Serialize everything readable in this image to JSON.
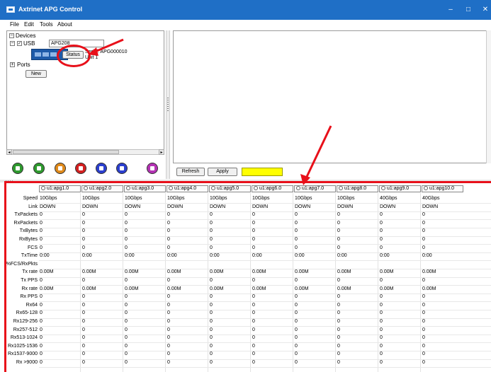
{
  "window": {
    "title": "Axtrinet APG Control",
    "minimize": "–",
    "maximize": "□",
    "close": "✕"
  },
  "menu": [
    "File",
    "Edit",
    "Tools",
    "About"
  ],
  "tree": {
    "devices_label": "Devices",
    "usb_label": "USB",
    "usb_name": "APG208",
    "status_button": "Status",
    "serial_text": "Serial: APG000010",
    "unit_text": "Unit 1",
    "ports_label": "Ports",
    "new_button": "New"
  },
  "controls": [
    {
      "name": "play-icon",
      "color": "#2e9a2e"
    },
    {
      "name": "step-icon",
      "color": "#2e9a2e"
    },
    {
      "name": "pause-icon",
      "color": "#e08a1a"
    },
    {
      "name": "stop-icon",
      "color": "#d42020"
    },
    {
      "name": "zero-icon",
      "color": "#2b3fcf"
    },
    {
      "name": "double-zero-icon",
      "color": "#2b3fcf"
    },
    {
      "name": "cycle-icon",
      "color": "#b432b4"
    }
  ],
  "right_panel": {
    "refresh_button": "Refresh",
    "apply_button": "Apply",
    "indicator_color": "#ffff00"
  },
  "stats": {
    "ports": [
      "u1:apg1.0",
      "u1:apg2.0",
      "u1:apg3.0",
      "u1:apg4.0",
      "u1:apg5.0",
      "u1:apg6.0",
      "u1:apg7.0",
      "u1:apg8.0",
      "u1:apg9.0",
      "u1:apg10.0"
    ],
    "rows": [
      {
        "label": "Speed",
        "values": [
          "10Gbps",
          "10Gbps",
          "10Gbps",
          "10Gbps",
          "10Gbps",
          "10Gbps",
          "10Gbps",
          "10Gbps",
          "40Gbps",
          "40Gbps"
        ]
      },
      {
        "label": "Link",
        "values": [
          "DOWN",
          "DOWN",
          "DOWN",
          "DOWN",
          "DOWN",
          "DOWN",
          "DOWN",
          "DOWN",
          "DOWN",
          "DOWN"
        ]
      },
      {
        "label": "TxPackets",
        "values": [
          "0",
          "0",
          "0",
          "0",
          "0",
          "0",
          "0",
          "0",
          "0",
          "0"
        ]
      },
      {
        "label": "RxPackets",
        "values": [
          "0",
          "0",
          "0",
          "0",
          "0",
          "0",
          "0",
          "0",
          "0",
          "0"
        ]
      },
      {
        "label": "TxBytes",
        "values": [
          "0",
          "0",
          "0",
          "0",
          "0",
          "0",
          "0",
          "0",
          "0",
          "0"
        ]
      },
      {
        "label": "RxBytes",
        "values": [
          "0",
          "0",
          "0",
          "0",
          "0",
          "0",
          "0",
          "0",
          "0",
          "0"
        ]
      },
      {
        "label": "FCS",
        "values": [
          "0",
          "0",
          "0",
          "0",
          "0",
          "0",
          "0",
          "0",
          "0",
          "0"
        ]
      },
      {
        "label": "TxTime",
        "values": [
          "0:00",
          "0:00",
          "0:00",
          "0:00",
          "0:00",
          "0:00",
          "0:00",
          "0:00",
          "0:00",
          "0:00"
        ]
      },
      {
        "label": "%FCS/RxPkts",
        "values": [
          "",
          "",
          "",
          "",
          "",
          "",
          "",
          "",
          "",
          ""
        ]
      },
      {
        "label": "Tx rate",
        "values": [
          "0.00M",
          "0.00M",
          "0.00M",
          "0.00M",
          "0.00M",
          "0.00M",
          "0.00M",
          "0.00M",
          "0.00M",
          "0.00M"
        ]
      },
      {
        "label": "Tx PPS",
        "values": [
          "0",
          "0",
          "0",
          "0",
          "0",
          "0",
          "0",
          "0",
          "0",
          "0"
        ]
      },
      {
        "label": "Rx rate",
        "values": [
          "0.00M",
          "0.00M",
          "0.00M",
          "0.00M",
          "0.00M",
          "0.00M",
          "0.00M",
          "0.00M",
          "0.00M",
          "0.00M"
        ]
      },
      {
        "label": "Rx PPS",
        "values": [
          "0",
          "0",
          "0",
          "0",
          "0",
          "0",
          "0",
          "0",
          "0",
          "0"
        ]
      },
      {
        "label": "Rx64",
        "values": [
          "0",
          "0",
          "0",
          "0",
          "0",
          "0",
          "0",
          "0",
          "0",
          "0"
        ]
      },
      {
        "label": "Rx65-128",
        "values": [
          "0",
          "0",
          "0",
          "0",
          "0",
          "0",
          "0",
          "0",
          "0",
          "0"
        ]
      },
      {
        "label": "Rx129-256",
        "values": [
          "0",
          "0",
          "0",
          "0",
          "0",
          "0",
          "0",
          "0",
          "0",
          "0"
        ]
      },
      {
        "label": "Rx257-512",
        "values": [
          "0",
          "0",
          "0",
          "0",
          "0",
          "0",
          "0",
          "0",
          "0",
          "0"
        ]
      },
      {
        "label": "Rx513-1024",
        "values": [
          "0",
          "0",
          "0",
          "0",
          "0",
          "0",
          "0",
          "0",
          "0",
          "0"
        ]
      },
      {
        "label": "Rx1025-1536",
        "values": [
          "0",
          "0",
          "0",
          "0",
          "0",
          "0",
          "0",
          "0",
          "0",
          "0"
        ]
      },
      {
        "label": "Rx1537-9000",
        "values": [
          "0",
          "0",
          "0",
          "0",
          "0",
          "0",
          "0",
          "0",
          "0",
          "0"
        ]
      },
      {
        "label": "Rx >9000",
        "values": [
          "0",
          "0",
          "0",
          "0",
          "0",
          "0",
          "0",
          "0",
          "0",
          "0"
        ]
      }
    ]
  },
  "annotation_color": "#e8101a"
}
